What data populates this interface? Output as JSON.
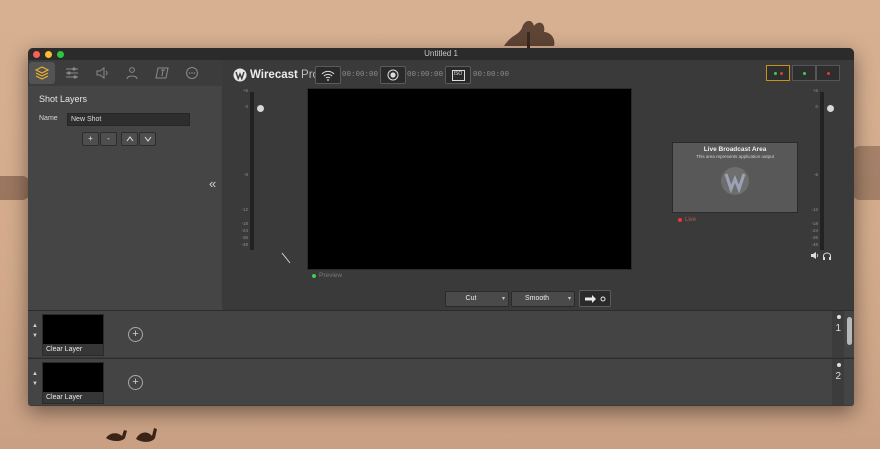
{
  "window": {
    "title": "Untitled 1"
  },
  "left_panel": {
    "tabs": [
      {
        "name": "shot-layers",
        "icon": "layers-icon",
        "selected": true
      },
      {
        "name": "settings",
        "icon": "sliders-icon",
        "selected": false
      },
      {
        "name": "audio",
        "icon": "speaker-icon",
        "selected": false
      },
      {
        "name": "source",
        "icon": "person-icon",
        "selected": false
      },
      {
        "name": "text",
        "icon": "text-icon",
        "selected": false
      },
      {
        "name": "more",
        "icon": "more-icon",
        "selected": false
      }
    ],
    "heading": "Shot Layers",
    "name_label": "Name",
    "name_value": "New Shot",
    "buttons": {
      "add": "+",
      "remove": "-",
      "up": "^",
      "down": "v"
    },
    "collapse_label": "«"
  },
  "toolbar": {
    "logo_bold": "Wirecast",
    "logo_light": " Pro",
    "stream_time": "00:00:00",
    "record_time": "00:00:00",
    "iso_time": "00:00:00",
    "iso_label": "ISO"
  },
  "meters": {
    "left_ticks": [
      "+6",
      "0",
      "-6",
      "-12",
      "-18",
      "-24",
      "-36",
      "-48"
    ],
    "right_ticks": [
      "+6",
      "0",
      "-6",
      "-12",
      "-18",
      "-24",
      "-36",
      "-48"
    ]
  },
  "preview": {
    "label": "Preview"
  },
  "live": {
    "title": "Live Broadcast Area",
    "subtitle": "This area represents application output",
    "label": "Live"
  },
  "transition": {
    "cut_label": "Cut",
    "smooth_label": "Smooth",
    "go_icon": "arrow-right-icon"
  },
  "layers": [
    {
      "thumb_label": "Clear Layer",
      "number": "1"
    },
    {
      "thumb_label": "Clear Layer",
      "number": "2"
    }
  ],
  "colors": {
    "accent_green": "#3fcf4a",
    "accent_red": "#e23a3a",
    "window_bg": "#3a3a3a",
    "panel_bg": "#454545"
  }
}
